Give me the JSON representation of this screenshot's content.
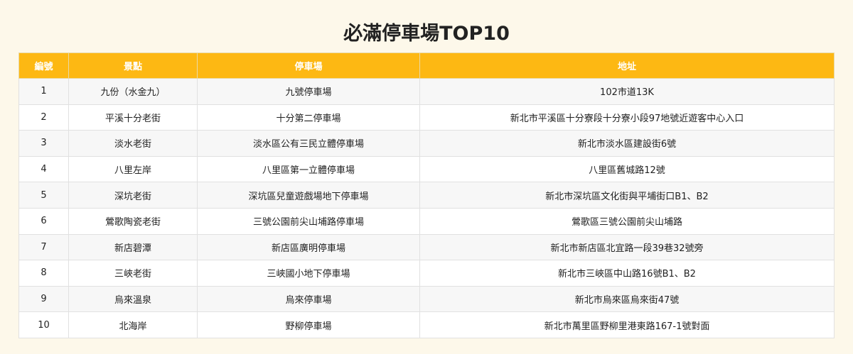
{
  "title": "必滿停車場TOP10",
  "columns": [
    "編號",
    "景點",
    "停車場",
    "地址"
  ],
  "rows": [
    {
      "no": "1",
      "spot": "九份（水金九）",
      "parking": "九號停車場",
      "address": "102市道13K"
    },
    {
      "no": "2",
      "spot": "平溪十分老街",
      "parking": "十分第二停車場",
      "address": "新北市平溪區十分寮段十分寮小段97地號近遊客中心入口"
    },
    {
      "no": "3",
      "spot": "淡水老街",
      "parking": "淡水區公有三民立體停車場",
      "address": "新北市淡水區建設街6號"
    },
    {
      "no": "4",
      "spot": "八里左岸",
      "parking": "八里區第一立體停車場",
      "address": "八里區舊城路12號"
    },
    {
      "no": "5",
      "spot": "深坑老街",
      "parking": "深坑區兒童遊戲場地下停車場",
      "address": "新北市深坑區文化街與平埔街口B1、B2"
    },
    {
      "no": "6",
      "spot": "鶯歌陶瓷老街",
      "parking": "三號公園前尖山埔路停車場",
      "address": "鶯歌區三號公園前尖山埔路"
    },
    {
      "no": "7",
      "spot": "新店碧潭",
      "parking": "新店區廣明停車場",
      "address": "新北市新店區北宜路一段39巷32號旁"
    },
    {
      "no": "8",
      "spot": "三峽老街",
      "parking": "三峽國小地下停車場",
      "address": "新北市三峽區中山路16號B1、B2"
    },
    {
      "no": "9",
      "spot": "烏來溫泉",
      "parking": "烏來停車場",
      "address": "新北市烏來區烏來街47號"
    },
    {
      "no": "10",
      "spot": "北海岸",
      "parking": "野柳停車場",
      "address": "新北市萬里區野柳里港東路167-1號對面"
    }
  ]
}
